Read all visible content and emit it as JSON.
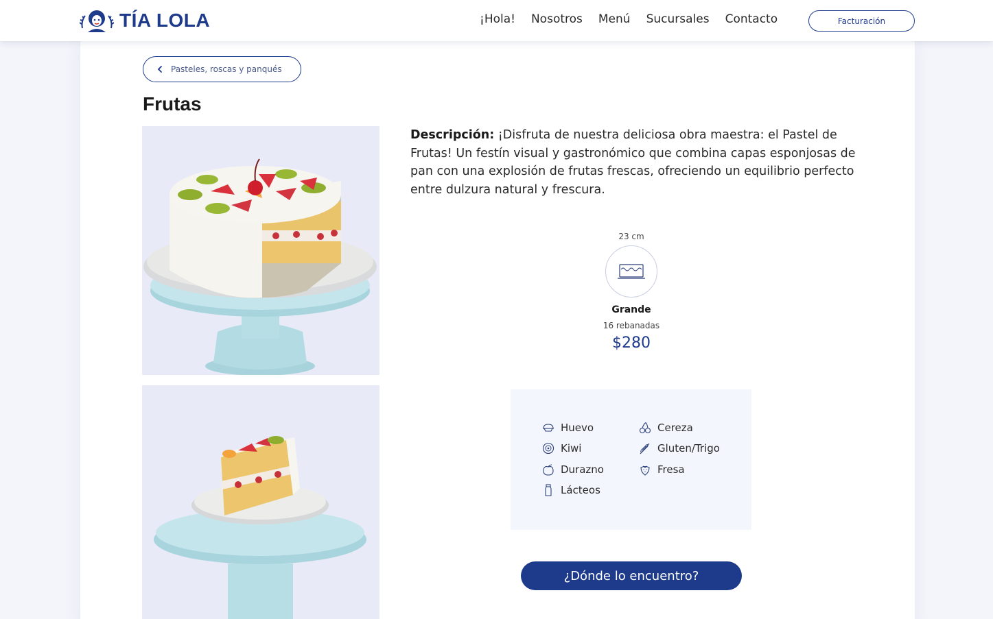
{
  "brand": {
    "name": "TÍA LOLA",
    "color": "#1e3a8a"
  },
  "nav": {
    "items": [
      "¡Hola!",
      "Nosotros",
      "Menú",
      "Sucursales",
      "Contacto"
    ],
    "billing_button": "Facturación"
  },
  "back": {
    "label": "Pasteles, roscas y panqués",
    "icon": "chevron-left-icon"
  },
  "product": {
    "title": "Frutas",
    "description_label": "Descripción:",
    "description_text": "¡Disfruta de nuestra deliciosa obra maestra: el Pastel de Frutas! Un festín visual y gastronómico que combina capas esponjosas de pan con una explosión de frutas frescas, ofreciendo un equilibrio perfecto entre dulzura natural y frescura.",
    "size": {
      "diameter": "23 cm",
      "name": "Grande",
      "slices": "16 rebanadas",
      "price": "$280",
      "icon": "cake-size-icon"
    },
    "ingredients": [
      {
        "label": "Huevo",
        "icon": "egg-icon"
      },
      {
        "label": "Kiwi",
        "icon": "kiwi-icon"
      },
      {
        "label": "Durazno",
        "icon": "peach-icon"
      },
      {
        "label": "Lácteos",
        "icon": "milk-bottle-icon"
      },
      {
        "label": "Cereza",
        "icon": "cherry-icon"
      },
      {
        "label": "Gluten/Trigo",
        "icon": "wheat-icon"
      },
      {
        "label": "Fresa",
        "icon": "strawberry-icon"
      }
    ],
    "cta": "¿Dónde lo encuentro?"
  }
}
